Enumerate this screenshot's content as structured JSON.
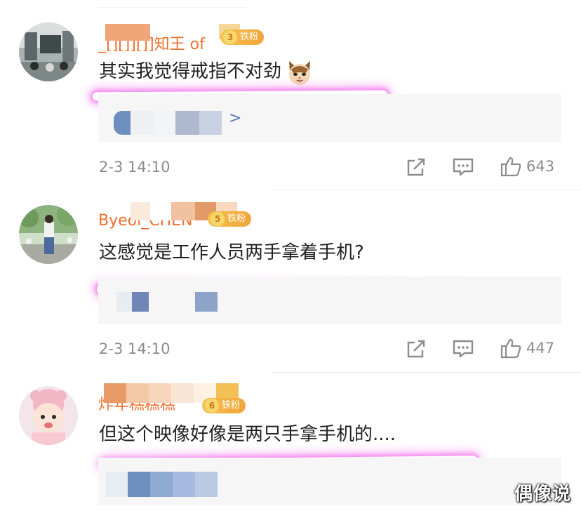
{
  "comments": [
    {
      "username": "_[][]][]]知王 of",
      "badge": "铁粉",
      "badge_level": "3",
      "text": "其实我觉得戒指不对劲",
      "emoji": "cat-face",
      "time": "2-3 14:10",
      "likes": "643",
      "reply_arrow": ">"
    },
    {
      "username": "Byeol_CHEN",
      "badge": "铁粉",
      "badge_level": "5",
      "text": "这感觉是工作人员两手拿着手机?",
      "time": "2-3 14:10",
      "likes": "447"
    },
    {
      "username": "炸年糕糕糕",
      "badge": "铁粉",
      "badge_level": "6",
      "text": "但这个映像好像是两只手拿手机的...."
    }
  ],
  "watermark": "偶像说",
  "colors": {
    "username": "#f26f2b",
    "highlight_glow": "#f48ef0",
    "meta_gray": "#8c8c8c",
    "reply_bg": "#f6f6f7"
  }
}
